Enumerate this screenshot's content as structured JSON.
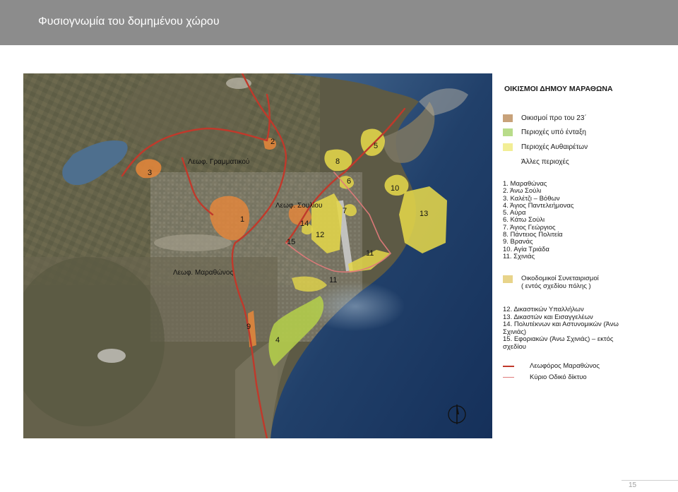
{
  "header": {
    "title": "Φυσιογνωμία του δομημένου χώρου"
  },
  "colors": {
    "header_bg": "#8c8c8c",
    "settlement_pre23": "#c8a27a",
    "inclusion_area": "#b8dc8a",
    "unauthorized_area": "#f2ee96",
    "cooperative": "#e8d48a",
    "main_avenue": "#c0392b",
    "road_network": "#e07a7a",
    "zone_orange": "#e8873a",
    "zone_yellow": "#e4d64a",
    "zone_green": "#b6d14a",
    "sea": "#2b4f7e"
  },
  "map": {
    "road_labels": {
      "grammatikou": "Λεωφ. Γραμματικού",
      "souliou": "Λεωφ. Σουλίου",
      "marathonos": "Λεωφ. Μαραθώνος"
    },
    "zone_numbers": [
      "1",
      "2",
      "3",
      "4",
      "5",
      "6",
      "7",
      "8",
      "9",
      "10",
      "11",
      "11",
      "12",
      "13",
      "14",
      "15"
    ],
    "icons": [
      "satellite-imagery",
      "north-arrow-icon"
    ]
  },
  "legend": {
    "title": "ΟΙΚΙΣΜΟΙ ΔΗΜΟΥ ΜΑΡΑΘΩΝΑ",
    "categories": [
      {
        "label": "Οικισμοί προ του 23΄"
      },
      {
        "label": "Περιοχές υπό ένταξη"
      },
      {
        "label": "Περιοχές Αυθαιρέτων"
      },
      {
        "label": "Άλλες περιοχές"
      }
    ],
    "settlements": [
      "1.  Μαραθώνας",
      "2.  Άνω Σούλι",
      "3.  Καλέτζι  –  Βόθων",
      "4.  Άγιος Παντελεήμονας",
      "5.  Αύρα",
      "6.  Κάτω Σούλι",
      "7.  Άγιος Γεώργιος",
      "8.  Πάντειος Πολιτεία",
      "9.  Βρανάς",
      "10.  Αγία Τριάδα",
      "11.  Σχινιάς"
    ],
    "cooperatives_title": "Οικοδομικοί Συνεταιρισμοί",
    "cooperatives_subtitle": "( εντός σχεδίου πόλης )",
    "cooperatives": [
      "12.   Δικαστικών Υπαλλήλων",
      "13.   Δικαστών και Εισαγγελέων",
      "14.   Πολυτέκνων και Αστυνομικών (Άνω Σχινιάς)",
      "15.   Εφοριακών (Άνω Σχινιάς)  –  εκτός σχεδίου"
    ],
    "roads": [
      {
        "label": "Λεωφόρος Μαραθώνος"
      },
      {
        "label": "Κύριο Οδικό δίκτυο"
      }
    ]
  },
  "page_number": "15"
}
